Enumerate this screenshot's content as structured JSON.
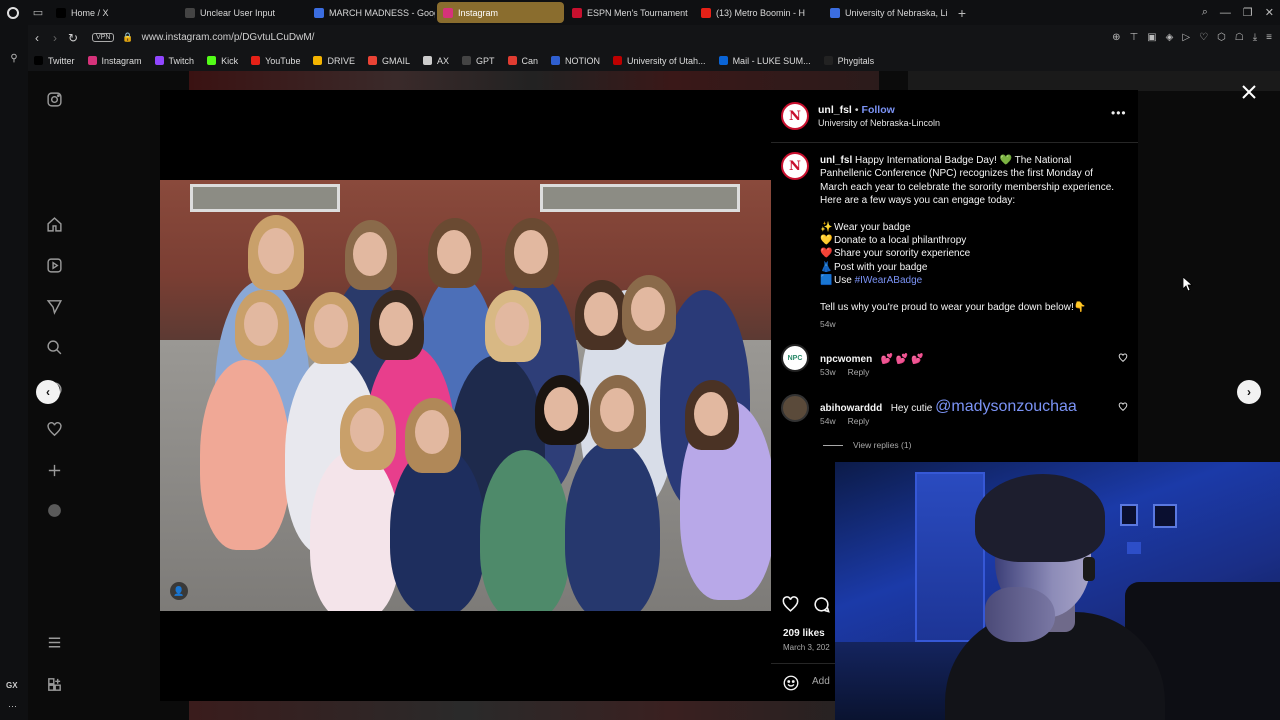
{
  "browser": {
    "tabs": [
      {
        "label": "Home / X",
        "icon": "x-logo-icon",
        "color": "#000000",
        "active": false
      },
      {
        "label": "Unclear User Input",
        "icon": "chatgpt-icon",
        "color": "#444444",
        "active": false
      },
      {
        "label": "MARCH MADNESS - Goog",
        "icon": "google-docs-icon",
        "color": "#3b6de0",
        "active": false
      },
      {
        "label": "Instagram",
        "icon": "instagram-icon",
        "color": "#d6327a",
        "active": true
      },
      {
        "label": "ESPN Men's Tournament",
        "icon": "espn-icon",
        "color": "#c8102e",
        "active": false
      },
      {
        "label": "(13) Metro Boomin - H",
        "icon": "youtube-icon",
        "color": "#e62117",
        "active": false
      },
      {
        "label": "University of Nebraska, Li",
        "icon": "website-icon",
        "color": "#3b6de0",
        "active": false
      }
    ],
    "vpn_label": "VPN",
    "url": "www.instagram.com/p/DGvtuLCuDwM/",
    "bookmarks": [
      {
        "label": "Twitter",
        "icon": "x-logo-icon",
        "color": "#000000"
      },
      {
        "label": "Instagram",
        "icon": "instagram-icon",
        "color": "#d6327a"
      },
      {
        "label": "Twitch",
        "icon": "twitch-icon",
        "color": "#9146ff"
      },
      {
        "label": "Kick",
        "icon": "kick-icon",
        "color": "#53fc18"
      },
      {
        "label": "YouTube",
        "icon": "youtube-icon",
        "color": "#e62117"
      },
      {
        "label": "DRIVE",
        "icon": "google-drive-icon",
        "color": "#f4b400"
      },
      {
        "label": "GMAIL",
        "icon": "gmail-icon",
        "color": "#ea4335"
      },
      {
        "label": "AX",
        "icon": "ax-icon",
        "color": "#cccccc"
      },
      {
        "label": "GPT",
        "icon": "chatgpt-icon",
        "color": "#444444"
      },
      {
        "label": "Can",
        "icon": "canvas-icon",
        "color": "#e03c31"
      },
      {
        "label": "NOTION",
        "icon": "notion-icon",
        "color": "#2f5fd0"
      },
      {
        "label": "University of Utah...",
        "icon": "utah-icon",
        "color": "#be0000"
      },
      {
        "label": "Mail - LUKE SUM...",
        "icon": "outlook-icon",
        "color": "#0a64d6"
      },
      {
        "label": "Phygitals",
        "icon": "phygitals-icon",
        "color": "#222222"
      }
    ]
  },
  "post": {
    "username": "unl_fsl",
    "follow_label": "Follow",
    "location": "University of Nebraska-Lincoln",
    "caption": {
      "username": "unl_fsl",
      "line1": "Happy International Badge Day! 💚 The National Panhellenic Conference (NPC) recognizes the first Monday of March each year to celebrate the sorority membership experience. Here are a few ways you can engage today:",
      "list": [
        {
          "emoji": "✨",
          "text": "Wear your badge"
        },
        {
          "emoji": "💛",
          "text": "Donate to a local philanthropy"
        },
        {
          "emoji": "❤️",
          "text": "Share your sorority experience"
        },
        {
          "emoji": "👗",
          "text": "Post with your badge"
        },
        {
          "emoji": "🟦",
          "text": "Use ",
          "hashtag": "#IWearABadge"
        }
      ],
      "closing": "Tell us why you're proud to wear your badge down below!👇",
      "time": "54w"
    },
    "comments": [
      {
        "username": "npcwomen",
        "text": "💕 💕 💕",
        "time": "53w",
        "reply_label": "Reply"
      },
      {
        "username": "abihowarddd",
        "text": "Hey cutie ",
        "mention": "@madysonzouchaa",
        "time": "54w",
        "reply_label": "Reply"
      }
    ],
    "view_replies": "View replies (1)",
    "likes": "209 likes",
    "date": "March 3, 202",
    "add_comment_placeholder": "Add"
  }
}
